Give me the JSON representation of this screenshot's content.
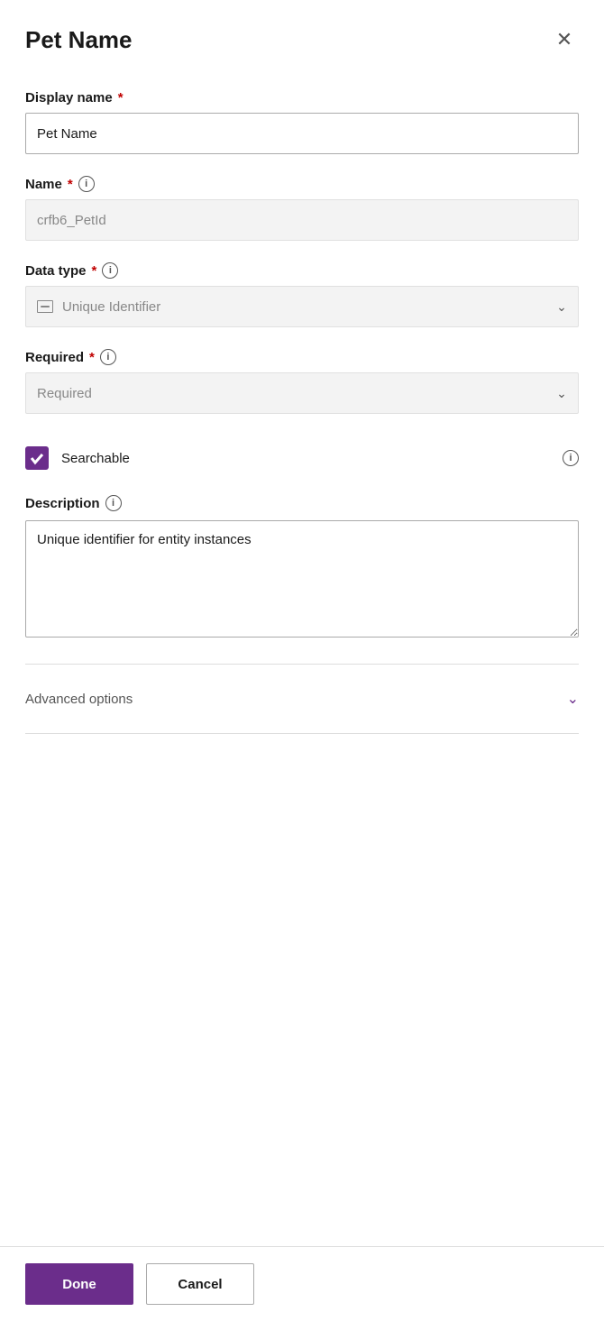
{
  "header": {
    "title": "Pet Name",
    "close_label": "×"
  },
  "fields": {
    "display_name": {
      "label": "Display name",
      "required": true,
      "value": "Pet Name",
      "placeholder": "Pet Name"
    },
    "name": {
      "label": "Name",
      "required": true,
      "placeholder": "crfb6_PetId",
      "readonly": true
    },
    "data_type": {
      "label": "Data type",
      "required": true,
      "value": "Unique Identifier",
      "readonly": true
    },
    "required": {
      "label": "Required",
      "required": true,
      "value": "Required",
      "readonly": true
    },
    "searchable": {
      "label": "Searchable",
      "checked": true
    },
    "description": {
      "label": "Description",
      "value": "Unique identifier for entity instances",
      "placeholder": ""
    }
  },
  "advanced_options": {
    "label": "Advanced options"
  },
  "footer": {
    "done_label": "Done",
    "cancel_label": "Cancel"
  },
  "icons": {
    "info": "i",
    "chevron_down": "∨",
    "close": "✕",
    "check": ""
  }
}
